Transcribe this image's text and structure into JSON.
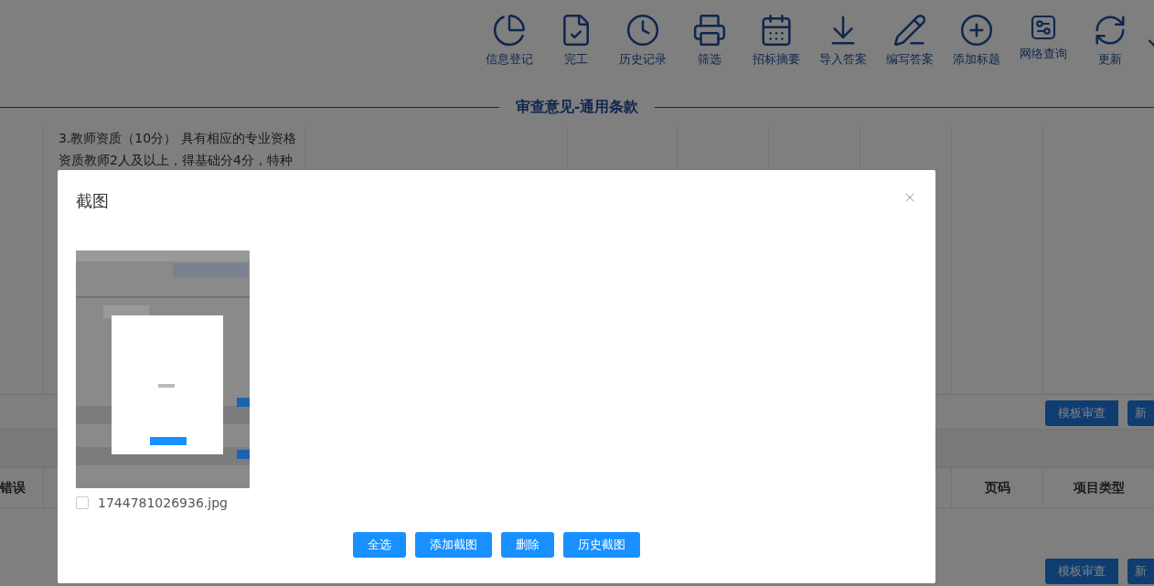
{
  "toolbar": {
    "items": [
      {
        "label": "信息登记"
      },
      {
        "label": "完工"
      },
      {
        "label": "历史记录"
      },
      {
        "label": "筛选"
      },
      {
        "label": "招标摘要"
      },
      {
        "label": "导入答案"
      },
      {
        "label": "编写答案"
      },
      {
        "label": "添加标题"
      },
      {
        "label": "网络查询"
      },
      {
        "label": "更新"
      }
    ]
  },
  "section_title": "审查意见-通用条款",
  "clause_text": [
    "3.教师资质（10分） 具有相应的专业资格",
    "资质教师2人及以上，得基础分4分，特种"
  ],
  "action_buttons_1": [
    "模板审查",
    "新"
  ],
  "error_table": {
    "columns": [
      {
        "label": "错误"
      },
      {
        "label": "页码"
      },
      {
        "label": "项目类型"
      }
    ]
  },
  "action_buttons_2": [
    "模板审查",
    "新"
  ],
  "dialog": {
    "title": "截图",
    "images": [
      {
        "filename": "1744781026936.jpg",
        "checked": false,
        "kind": "picture"
      }
    ],
    "buttons": [
      "全选",
      "添加截图",
      "删除",
      "历史截图"
    ]
  }
}
